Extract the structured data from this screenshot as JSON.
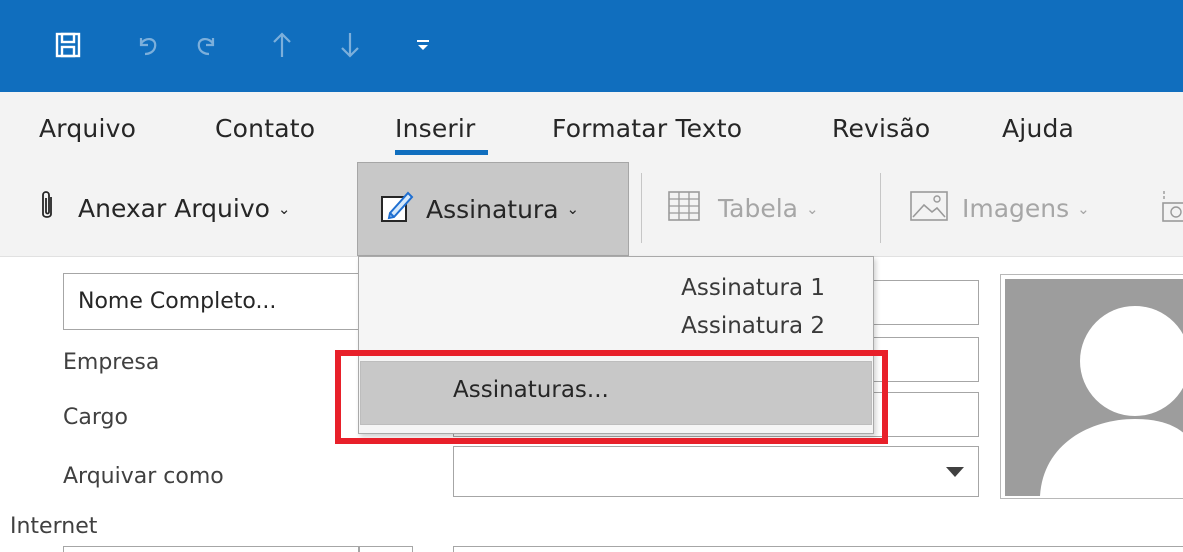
{
  "quick_access": {
    "items": [
      "save-icon",
      "undo-icon",
      "redo-icon",
      "up-arrow-icon",
      "down-arrow-icon",
      "customize-toolbar-icon"
    ]
  },
  "ribbon": {
    "tabs": [
      {
        "label": "Arquivo"
      },
      {
        "label": "Contato"
      },
      {
        "label": "Inserir",
        "selected": true
      },
      {
        "label": "Formatar Texto"
      },
      {
        "label": "Revisão"
      },
      {
        "label": "Ajuda"
      }
    ],
    "commands": {
      "attach_file": "Anexar Arquivo",
      "signature": "Assinatura",
      "table": "Tabela",
      "images": "Imagens"
    }
  },
  "form": {
    "full_name_button": "Nome Completo...",
    "company_label": "Empresa",
    "job_title_label": "Cargo",
    "file_as_label": "Arquivar como",
    "internet_label": "Internet"
  },
  "signature_menu": {
    "items": [
      "Assinatura 1",
      "Assinatura 2"
    ],
    "manage_label": "Assinaturas..."
  },
  "colors": {
    "title_bar": "#106ebe",
    "ribbon_bg": "#f3f3f3",
    "highlight": "#e8202a",
    "photo_placeholder": "#9d9d9d"
  }
}
